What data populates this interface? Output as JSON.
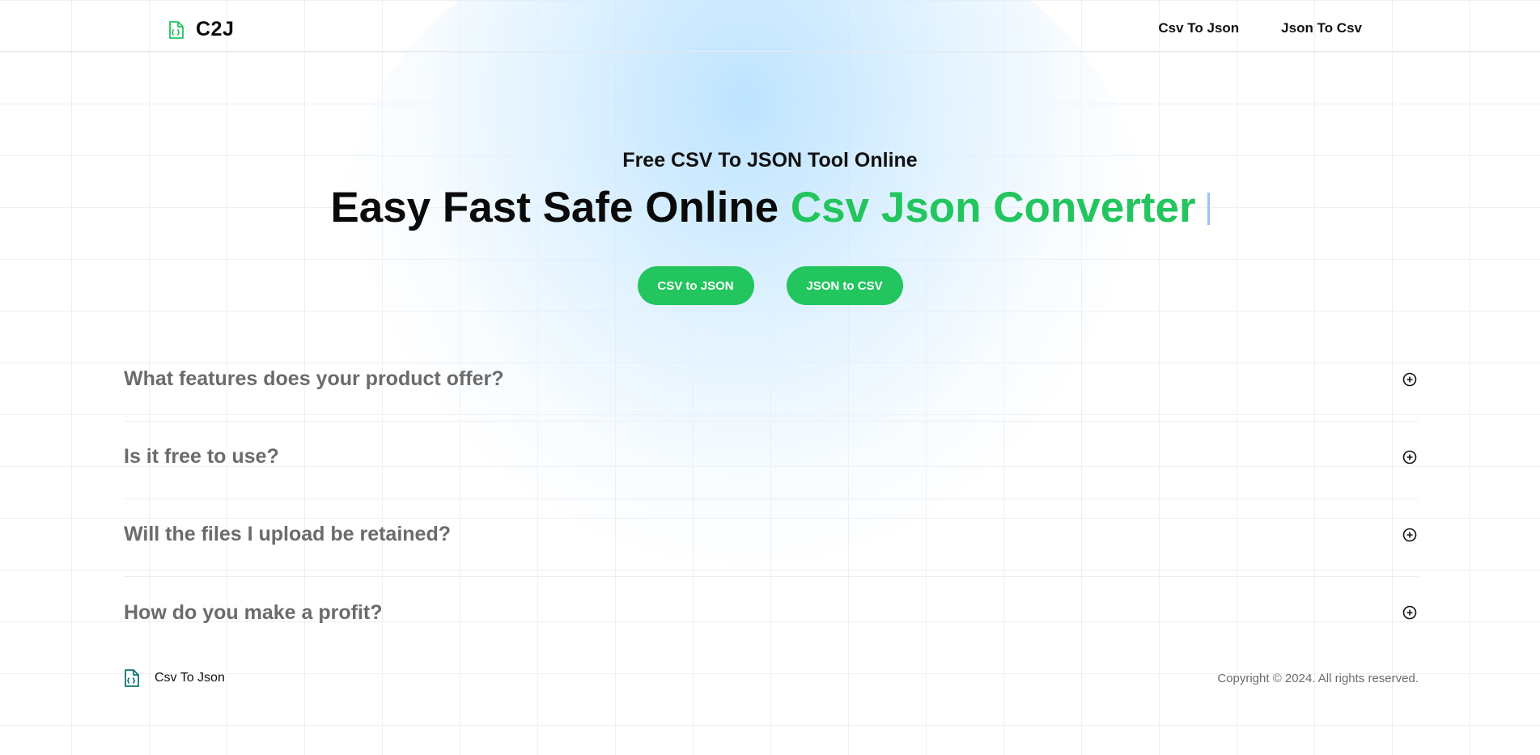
{
  "header": {
    "logo_text": "C2J",
    "nav": [
      "Csv To Json",
      "Json To Csv"
    ]
  },
  "hero": {
    "subtitle": "Free CSV To JSON Tool Online",
    "title_plain": "Easy Fast Safe Online ",
    "title_accent": "Csv Json Converter",
    "buttons": [
      "CSV to JSON",
      "JSON to CSV"
    ]
  },
  "faq": {
    "items": [
      "What features does your product offer?",
      "Is it free to use?",
      "Will the files I upload be retained?",
      "How do you make a profit?"
    ],
    "expand_icon": "plus-circle-icon"
  },
  "footer": {
    "brand": "Csv To Json",
    "copyright": "Copyright © 2024. All rights reserved."
  },
  "colors": {
    "accent": "#22c55e",
    "faq_text": "#6b6b6b",
    "caret": "#93c5fd",
    "glow": "#bae2ff"
  }
}
